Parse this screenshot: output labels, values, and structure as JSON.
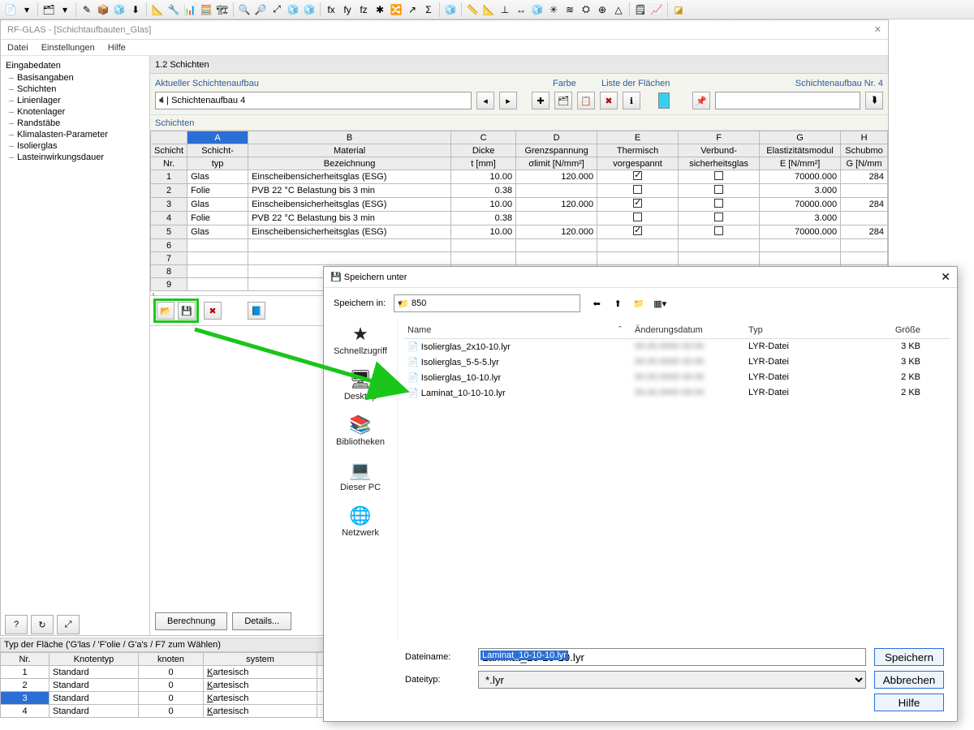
{
  "window": {
    "title": "RF-GLAS - [Schichtaufbauten_Glas]"
  },
  "menu": {
    "items": [
      "Datei",
      "Einstellungen",
      "Hilfe"
    ]
  },
  "sidebar": {
    "root": "Eingabedaten",
    "items": [
      "Basisangaben",
      "Schichten",
      "Linienlager",
      "Knotenlager",
      "Randstäbe",
      "Klimalasten-Parameter",
      "Isolierglas",
      "Lasteinwirkungsdauer"
    ]
  },
  "panel": {
    "title": "1.2 Schichten",
    "aktueller_label": "Aktueller Schichtenaufbau",
    "combo_value": "4 | Schichtenaufbau 4",
    "farbe_label": "Farbe",
    "liste_label": "Liste der Flächen",
    "aufbau_nr": "Schichtenaufbau Nr. 4",
    "schichten_label": "Schichten"
  },
  "grid": {
    "col_letters": [
      "A",
      "B",
      "C",
      "D",
      "E",
      "F",
      "G",
      "H"
    ],
    "headers1": [
      "Schicht",
      "Schicht-",
      "Material",
      "Dicke",
      "Grenzspannung",
      "Thermisch",
      "Verbund-",
      "Elastizitätsmodul",
      "Schubmo"
    ],
    "headers2": [
      "Nr.",
      "typ",
      "Bezeichnung",
      "t [mm]",
      "σlimit [N/mm²]",
      "vorgespannt",
      "sicherheitsglas",
      "E [N/mm²]",
      "G [N/mm"
    ],
    "rows": [
      {
        "nr": "1",
        "typ": "Glas",
        "mat": "Einscheibensicherheitsglas (ESG)",
        "t": "10.00",
        "sig": "120.000",
        "therm": true,
        "vsg": false,
        "e": "70000.000",
        "g": "284"
      },
      {
        "nr": "2",
        "typ": "Folie",
        "mat": "PVB 22 °C Belastung bis 3 min",
        "t": "0.38",
        "sig": "",
        "therm": false,
        "vsg": false,
        "e": "3.000",
        "g": ""
      },
      {
        "nr": "3",
        "typ": "Glas",
        "mat": "Einscheibensicherheitsglas (ESG)",
        "t": "10.00",
        "sig": "120.000",
        "therm": true,
        "vsg": false,
        "e": "70000.000",
        "g": "284"
      },
      {
        "nr": "4",
        "typ": "Folie",
        "mat": "PVB 22 °C Belastung bis 3 min",
        "t": "0.38",
        "sig": "",
        "therm": false,
        "vsg": false,
        "e": "3.000",
        "g": ""
      },
      {
        "nr": "5",
        "typ": "Glas",
        "mat": "Einscheibensicherheitsglas (ESG)",
        "t": "10.00",
        "sig": "120.000",
        "therm": true,
        "vsg": false,
        "e": "70000.000",
        "g": "284"
      },
      {
        "nr": "6"
      },
      {
        "nr": "7"
      },
      {
        "nr": "8"
      },
      {
        "nr": "9"
      }
    ]
  },
  "buttons": {
    "berechnung": "Berechnung",
    "details": "Details..."
  },
  "typbar": "Typ der Fläche ('G'las / 'F'olie / G'a's / F7 zum Wählen)",
  "bottom_table": {
    "headers": [
      "Nr.",
      "Knotentyp",
      "knoten",
      "system"
    ],
    "rows": [
      {
        "nr": "1",
        "kt": "Standard",
        "kn": "0",
        "sys": "Kartesisch"
      },
      {
        "nr": "2",
        "kt": "Standard",
        "kn": "0",
        "sys": "Kartesisch"
      },
      {
        "nr": "3",
        "kt": "Standard",
        "kn": "0",
        "sys": "Kartesisch",
        "sel": true
      },
      {
        "nr": "4",
        "kt": "Standard",
        "kn": "0",
        "sys": "Kartesisch"
      }
    ]
  },
  "dialog": {
    "title": "Speichern unter",
    "save_in_label": "Speichern in:",
    "folder": "850",
    "columns": {
      "name": "Name",
      "date": "Änderungsdatum",
      "typ": "Typ",
      "size": "Größe"
    },
    "files": [
      {
        "name": "Isolierglas_2x10-10.lyr",
        "typ": "LYR-Datei",
        "size": "3 KB"
      },
      {
        "name": "Isolierglas_5-5-5.lyr",
        "typ": "LYR-Datei",
        "size": "3 KB"
      },
      {
        "name": "Isolierglas_10-10.lyr",
        "typ": "LYR-Datei",
        "size": "2 KB"
      },
      {
        "name": "Laminat_10-10-10.lyr",
        "typ": "LYR-Datei",
        "size": "2 KB"
      }
    ],
    "places": [
      {
        "label": "Schnellzugriff",
        "icon": "★"
      },
      {
        "label": "Desktop",
        "icon": "🖥"
      },
      {
        "label": "Bibliotheken",
        "icon": "📚"
      },
      {
        "label": "Dieser PC",
        "icon": "💻"
      },
      {
        "label": "Netzwerk",
        "icon": "🌐"
      }
    ],
    "filename_label": "Dateiname:",
    "filetype_label": "Dateityp:",
    "filename": "Laminat_10-10-10.lyr",
    "filetype": "*.lyr",
    "btn_save": "Speichern",
    "btn_cancel": "Abbrechen",
    "btn_help": "Hilfe"
  }
}
